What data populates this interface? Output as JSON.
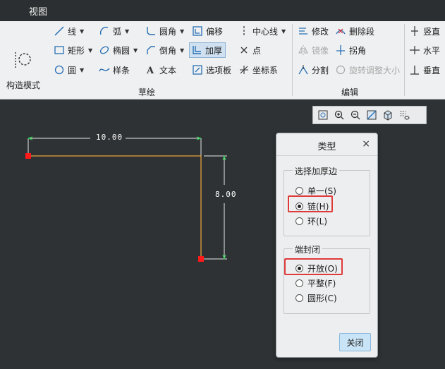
{
  "menubar": {
    "tab_view": "视图"
  },
  "ribbon": {
    "construct_mode": "构造模式",
    "sketch_group": "草绘",
    "edit_group": "编辑",
    "items": {
      "line": "线",
      "arc": "弧",
      "fillet": "圆角",
      "offset": "偏移",
      "centerline": "中心线",
      "rectangle": "矩形",
      "ellipse": "椭圆",
      "chamfer": "倒角",
      "thicken": "加厚",
      "point": "点",
      "circle": "圆",
      "spline": "样条",
      "text": "文本",
      "palette": "选项板",
      "coord_sys": "坐标系",
      "modify": "修改",
      "delete_segment": "删除段",
      "mirror": "镜像",
      "corner": "拐角",
      "divide": "分割",
      "rotate_resize": "旋转调整大小",
      "vertical": "竖直",
      "horizontal": "水平",
      "perpendicular": "垂直"
    }
  },
  "sketch": {
    "dim_horizontal": "10.00",
    "dim_vertical": "8.00"
  },
  "dialog": {
    "title": "类型",
    "close_x": "×",
    "group_select": "选择加厚边",
    "opt_single": "单一(S)",
    "opt_chain": "链(H)",
    "opt_loop": "环(L)",
    "group_end": "端封闭",
    "opt_open": "开放(O)",
    "opt_flat": "平整(F)",
    "opt_round": "圆形(C)",
    "close_button": "关闭",
    "selected_edge": "opt_chain",
    "selected_end": "opt_open"
  },
  "colors": {
    "highlight": "#e03b3b",
    "sketch_line": "#e8a23a",
    "dimension": "#ffffff",
    "endpoint": "#ff1a1a"
  }
}
